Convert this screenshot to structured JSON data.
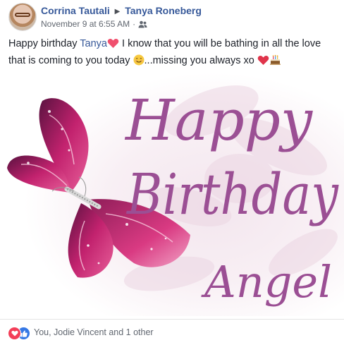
{
  "post": {
    "author": "Corrina Tautali",
    "target": "Tanya Roneberg",
    "timestamp": "November 9 at 6:55 AM",
    "audience_icon": "friends-icon",
    "message": {
      "part1": "Happy birthday ",
      "mention": "Tanya",
      "part2": " I know that you will be bathing in all the love that is coming to you today ",
      "part3": "...missing you always xo "
    },
    "image": {
      "line1": "Happy",
      "line2": "Birthday",
      "line3": "Angel"
    },
    "reactions": {
      "icons": [
        "love-reaction-icon",
        "like-reaction-icon"
      ],
      "summary": "You, Jodie Vincent and 1 other"
    }
  },
  "colors": {
    "link": "#365899",
    "meta": "#616770",
    "heart": "#f33e58",
    "like": "#3578e5",
    "script_text": "#9b4f94"
  }
}
